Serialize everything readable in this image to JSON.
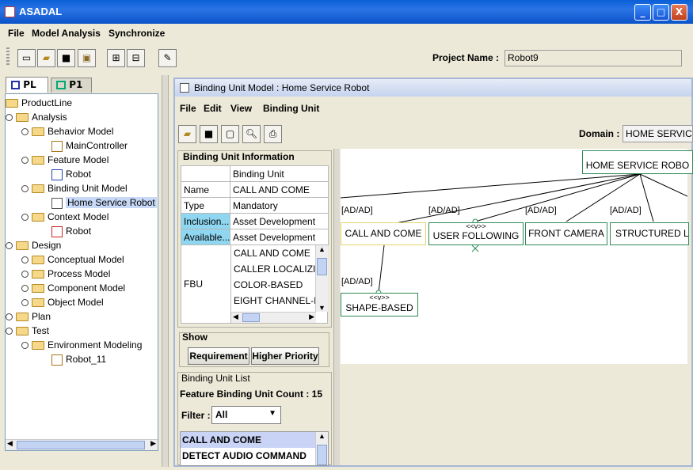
{
  "window": {
    "title": "ASADAL",
    "min": "_",
    "max": "□",
    "close": "X"
  },
  "menubar": [
    "File",
    "Model Analysis",
    "Synchronize"
  ],
  "project": {
    "label": "Project Name :",
    "value": "Robot9"
  },
  "tabs": [
    {
      "label": "PL"
    },
    {
      "label": "P1"
    }
  ],
  "tree": [
    {
      "label": "ProductLine",
      "icon": "folder-icon"
    },
    {
      "label": "Analysis",
      "icon": "folder-icon"
    },
    {
      "label": "Behavior Model",
      "icon": "folder-icon"
    },
    {
      "label": "MainController",
      "icon": "diagram-icon"
    },
    {
      "label": "Feature Model",
      "icon": "folder-icon"
    },
    {
      "label": "Robot",
      "icon": "feature-diagram-icon"
    },
    {
      "label": "Binding Unit Model",
      "icon": "folder-icon"
    },
    {
      "label": "Home Service Robot",
      "icon": "binding-diagram-icon"
    },
    {
      "label": "Context Model",
      "icon": "folder-icon"
    },
    {
      "label": "Robot",
      "icon": "context-diagram-icon"
    },
    {
      "label": "Design",
      "icon": "folder-icon"
    },
    {
      "label": "Conceptual Model",
      "icon": "folder-icon"
    },
    {
      "label": "Process Model",
      "icon": "folder-icon"
    },
    {
      "label": "Component Model",
      "icon": "folder-icon"
    },
    {
      "label": "Object Model",
      "icon": "folder-icon"
    },
    {
      "label": "Plan",
      "icon": "folder-icon"
    },
    {
      "label": "Test",
      "icon": "folder-icon"
    },
    {
      "label": "Environment Modeling",
      "icon": "folder-icon"
    },
    {
      "label": "Robot_11",
      "icon": "diagram-icon"
    }
  ],
  "inner": {
    "title": "Binding Unit Model : Home Service Robot",
    "menu": [
      "File",
      "Edit",
      "View",
      "Binding Unit"
    ],
    "domain_label": "Domain :",
    "domain_value": "HOME SERVIC"
  },
  "info": {
    "title": "Binding Unit Information",
    "header": "Binding Unit",
    "rows": [
      {
        "k": "Name",
        "v": "CALL AND COME"
      },
      {
        "k": "Type",
        "v": "Mandatory"
      },
      {
        "k": "Inclusion...",
        "v": "Asset Development"
      },
      {
        "k": "Available...",
        "v": "Asset Development"
      }
    ],
    "fbu_label": "FBU",
    "fbu_items": [
      "CALL AND COME",
      "CALLER LOCALIZI",
      "COLOR-BASED",
      "EIGHT CHANNEL-I"
    ]
  },
  "show": {
    "title": "Show",
    "req": "Requirement",
    "hp": "Higher Priority"
  },
  "list": {
    "title": "Binding Unit List",
    "count": "Feature Binding Unit Count : 15",
    "filter_label": "Filter :",
    "filter_value": "All",
    "items": [
      "CALL AND COME",
      "DETECT AUDIO COMMAND"
    ]
  },
  "diagram": {
    "root": "HOME SERVICE ROBO",
    "tag": "[AD/AD]",
    "stereo": "<<v>>",
    "nodes": [
      "CALL AND COME",
      "USER FOLLOWING",
      "FRONT CAMERA",
      "STRUCTURED L",
      "SHAPE-BASED"
    ]
  }
}
